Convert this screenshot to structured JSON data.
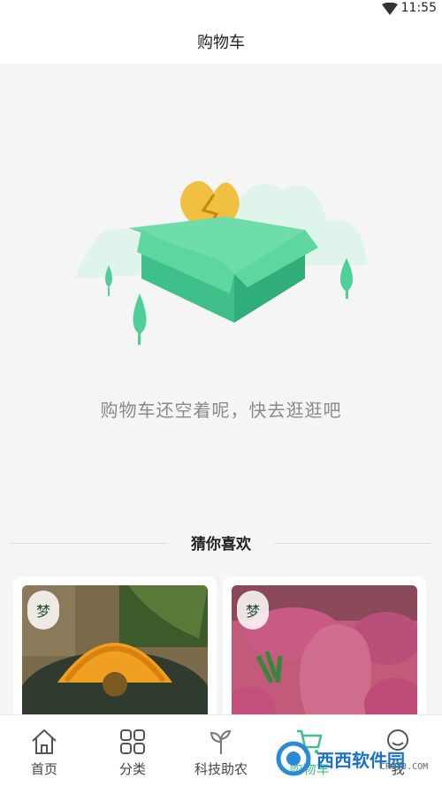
{
  "status_bar": {
    "time": "11:55"
  },
  "header": {
    "title": "购物车"
  },
  "empty_state": {
    "message": "购物车还空着呢，快去逛逛吧"
  },
  "recommend": {
    "title": "猜你喜欢",
    "items": [
      {
        "brand_mark": "梦"
      },
      {
        "brand_mark": "梦"
      }
    ]
  },
  "tabbar": {
    "items": [
      {
        "label": "首页",
        "icon": "home-icon"
      },
      {
        "label": "分类",
        "icon": "grid-icon"
      },
      {
        "label": "科技助农",
        "icon": "sprout-icon"
      },
      {
        "label": "购物车",
        "icon": "cart-icon",
        "active": true
      },
      {
        "label": "我",
        "icon": "user-icon"
      }
    ]
  },
  "watermark": {
    "text": "西西软件园",
    "site": "CR173.COM"
  },
  "colors": {
    "accent": "#3fbf8a",
    "heart": "#f0c040",
    "box": "#4fcf9a"
  }
}
